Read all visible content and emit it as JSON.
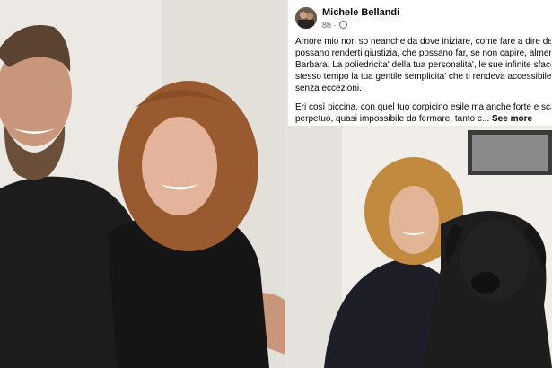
{
  "post": {
    "author": "Michele Bellandi",
    "time": "8h",
    "paragraph1": [
      "Amore mio non so neanche da dove iniziare, come fare a dire delle c",
      "possano renderti giustizia, che possano far, se non capire, almeno in",
      "Barbara.  La poliedricita' della tua personalita', le sue infinite sfaccetta",
      "stesso tempo la tua gentile semplicita' che ti rendeva accessibile ed a",
      "senza eccezioni."
    ],
    "paragraph2": [
      "Eri così piccina, con quel tuo corpicino esile ma anche forte e scattar",
      "perpetuo, quasi impossibile da fermare, tanto c..."
    ],
    "see_more": "See more"
  },
  "colors": {
    "text": "#050505",
    "meta": "#65676b",
    "divider": "#e4e4e4"
  },
  "icons": [
    "globe-icon"
  ]
}
